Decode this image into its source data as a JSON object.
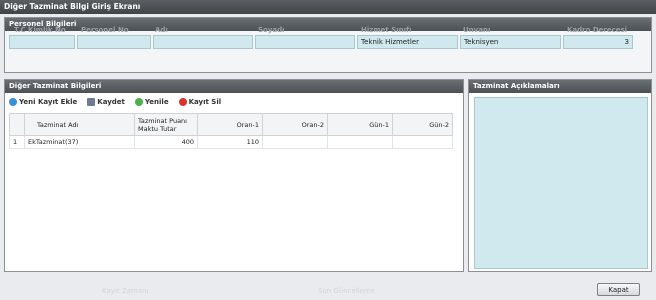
{
  "window": {
    "title": "Diğer Tazminat Bilgi Giriş Ekranı"
  },
  "personel": {
    "header": "Personel Bilgileri",
    "fields": [
      {
        "label": "T.C Kimlik No",
        "value": ""
      },
      {
        "label": "Personel No",
        "value": ""
      },
      {
        "label": "Adı",
        "value": ""
      },
      {
        "label": "Soyadı",
        "value": ""
      },
      {
        "label": "Hizmet Sınıfı",
        "value": "Teknik Hizmetler"
      },
      {
        "label": "Unvanı",
        "value": "Teknisyen"
      },
      {
        "label": "Kadro Derecesi",
        "value": "3"
      }
    ]
  },
  "tazminat": {
    "header": "Diğer Tazminat Bilgileri",
    "toolbar": {
      "new": "Yeni Kayıt Ekle",
      "save": "Kaydet",
      "refresh": "Yenile",
      "delete": "Kayıt Sil"
    },
    "columns": [
      "Tazminat Adı",
      "Tazminat Puanı Maktu Tutar",
      "Oran-1",
      "Oran-2",
      "Gün-1",
      "Gün-2"
    ],
    "rows": [
      {
        "index": "1",
        "name": "EkTazminat(37)",
        "puan": "400",
        "oran1": "110",
        "oran2": "",
        "gun1": "",
        "gun2": ""
      }
    ]
  },
  "aciklama": {
    "header": "Tazminat Açıklamaları"
  },
  "footer": {
    "close": "Kapat",
    "ghost1": "Kayıt Zamanı",
    "ghost2": "Son Güncelleme"
  }
}
